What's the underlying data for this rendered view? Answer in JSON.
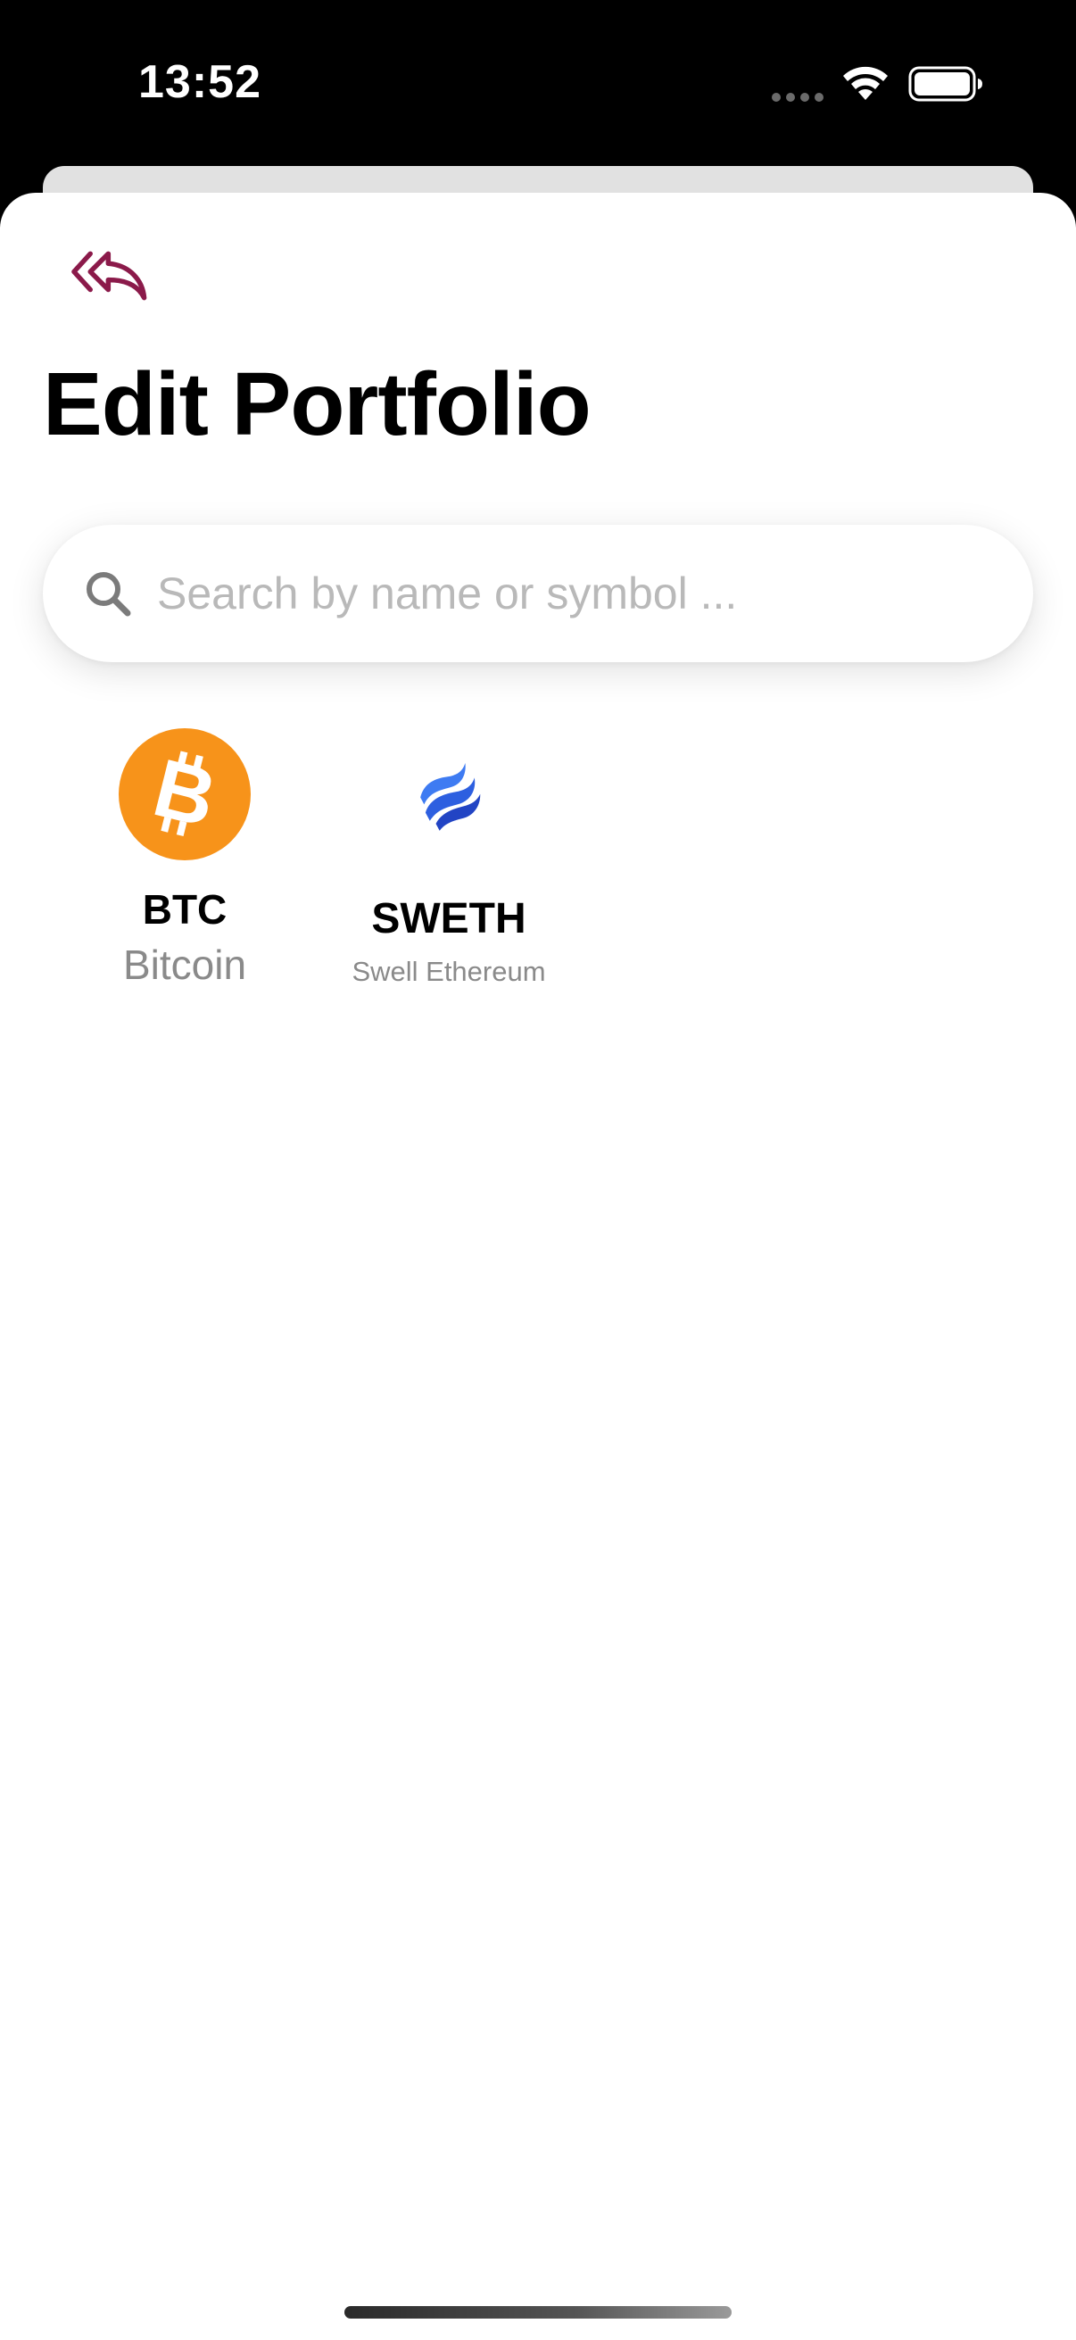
{
  "status_bar": {
    "time": "13:52"
  },
  "header": {
    "back_icon": "double-reply-arrow-icon",
    "title": "Edit Portfolio"
  },
  "search": {
    "placeholder": "Search by name or symbol ...",
    "value": "",
    "icon": "magnifying-glass-icon"
  },
  "coins": [
    {
      "symbol": "BTC",
      "name": "Bitcoin",
      "logo": "bitcoin-logo",
      "logo_color": "#F7931A"
    },
    {
      "symbol": "SWETH",
      "name": "Swell Ethereum",
      "logo": "swell-ethereum-logo",
      "logo_color": "#3068EF"
    }
  ],
  "colors": {
    "accent": "#8B1A4A",
    "background": "#FFFFFF",
    "placeholder": "#B9B9B9",
    "secondary_text": "#8A8A8A"
  }
}
